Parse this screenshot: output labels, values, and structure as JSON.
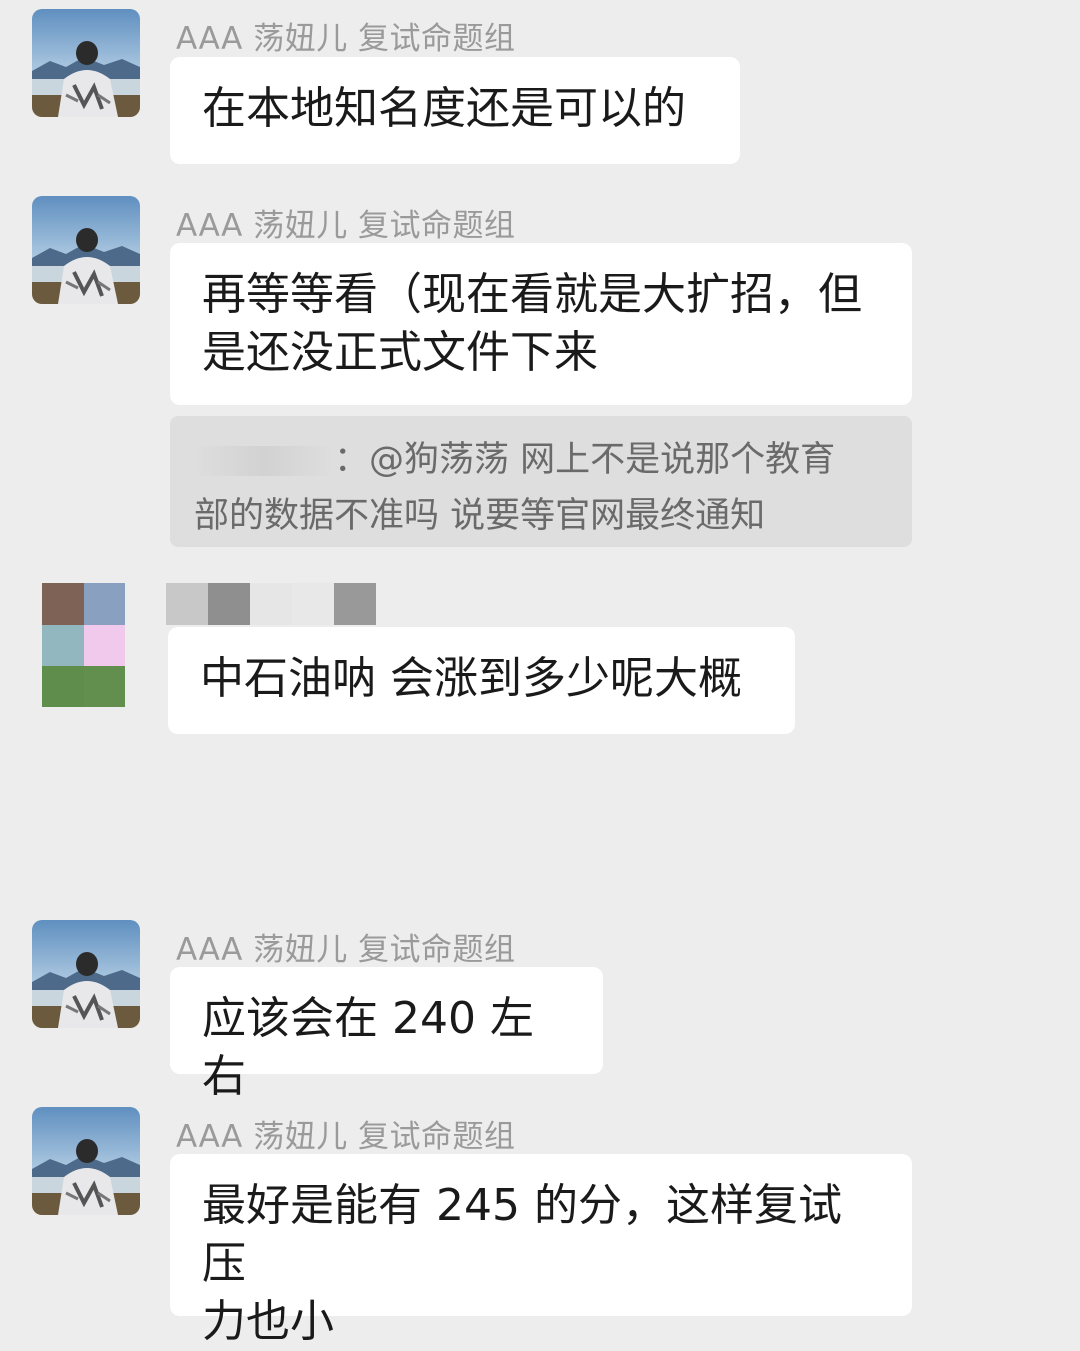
{
  "colors": {
    "background": "#ededed",
    "bubble": "#ffffff",
    "quote_background": "#dedede",
    "sender_text": "#9a9a9a",
    "message_text": "#1a1a1a"
  },
  "messages": [
    {
      "sender": "AAA 荡妞儿 复试命题组",
      "line1": "在本地知名度还是可以的"
    },
    {
      "sender": "AAA 荡妞儿 复试命题组",
      "line1": "再等等看（现在看就是大扩招，但",
      "line2": "是还没正式文件下来",
      "quote": {
        "prefix": "：",
        "line1": "@狗荡荡 网上不是说那个教育",
        "line2": "部的数据不准吗 说要等官网最终通知"
      }
    },
    {
      "sender": "",
      "line1": "中石油呐 会涨到多少呢大概"
    },
    {
      "sender": "AAA 荡妞儿 复试命题组",
      "line1": "应该会在 240 左右"
    },
    {
      "sender": "AAA 荡妞儿 复试命题组",
      "line1": "最好是能有 245 的分，这样复试压",
      "line2": "力也小"
    }
  ],
  "icons": {
    "avatar": "person-landscape-avatar-icon",
    "mosaic_avatar": "pixelated-avatar-icon"
  }
}
